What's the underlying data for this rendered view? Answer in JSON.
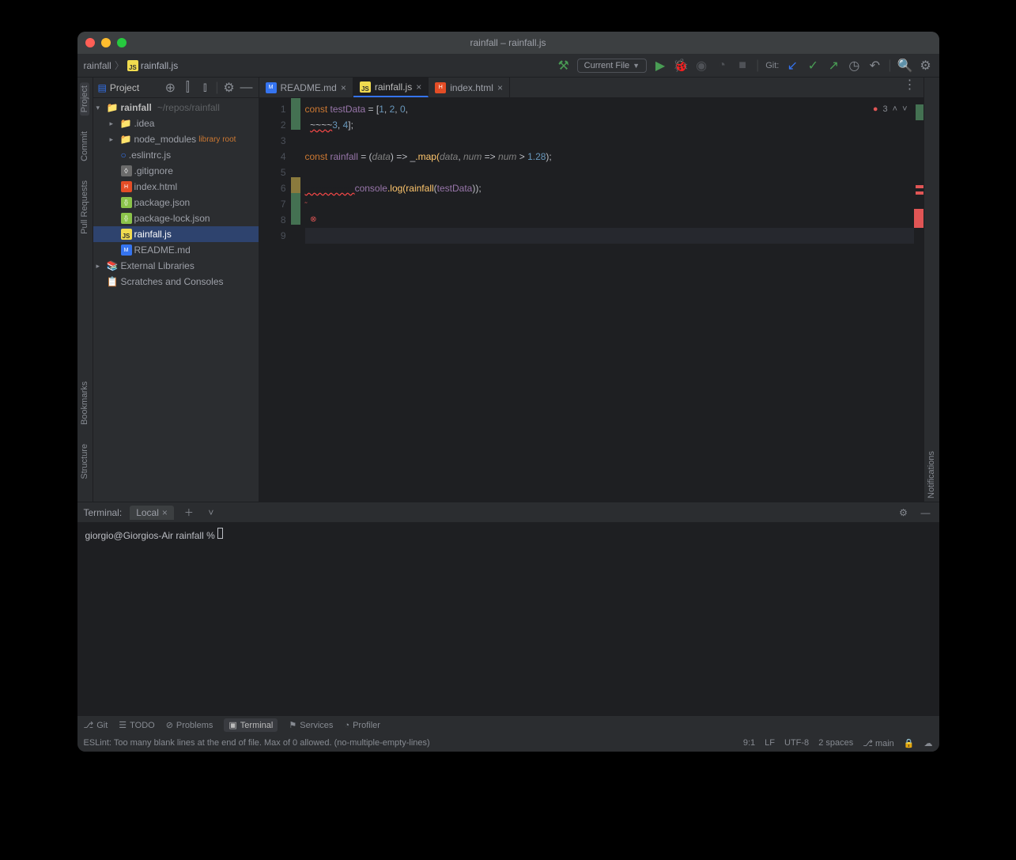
{
  "window": {
    "title": "rainfall – rainfall.js"
  },
  "breadcrumbs": {
    "project": "rainfall",
    "file": "rainfall.js"
  },
  "toolbar": {
    "run_config": "Current File",
    "git_label": "Git:"
  },
  "sidebar": {
    "title": "Project",
    "tree": {
      "root": "rainfall",
      "root_path": "~/repos/rainfall",
      "idea": ".idea",
      "node_modules": "node_modules",
      "lib_root": "library root",
      "eslintrc": ".eslintrc.js",
      "gitignore": ".gitignore",
      "index_html": "index.html",
      "package_json": "package.json",
      "package_lock": "package-lock.json",
      "rainfall_js": "rainfall.js",
      "readme": "README.md",
      "ext_libs": "External Libraries",
      "scratches": "Scratches and Consoles"
    }
  },
  "left_rail": {
    "project": "Project",
    "commit": "Commit",
    "pull_requests": "Pull Requests",
    "structure": "Structure",
    "bookmarks": "Bookmarks"
  },
  "right_rail": {
    "notifications": "Notifications"
  },
  "tabs": [
    {
      "label": "README.md",
      "type": "md"
    },
    {
      "label": "rainfall.js",
      "type": "js",
      "active": true
    },
    {
      "label": "index.html",
      "type": "html"
    }
  ],
  "editor": {
    "inspection": {
      "errors": 3
    },
    "lines": [
      "1",
      "2",
      "3",
      "4",
      "5",
      "6",
      "7",
      "8",
      "9"
    ],
    "code": {
      "l1_kw": "const ",
      "l1_var": "testData",
      "l1_op": " = [",
      "l1_n1": "1",
      "l1_c": ", ",
      "l1_n2": "2",
      "l1_n3": "0",
      "l2_sq": "~~~~",
      "l2_n1": "3",
      "l2_n2": "4",
      "l2_end": "];",
      "l4_kw": "const ",
      "l4_var": "rainfall",
      "l4_op": " = (",
      "l4_p": "data",
      "l4_ar": ") => ",
      "l4_u": "_",
      "l4_map": ".map(",
      "l4_d": "data",
      "l4_c": ", ",
      "l4_n": "num",
      "l4_ar2": " => ",
      "l4_n2": "num",
      "l4_gt": " > ",
      "l4_val": "1.28",
      "l4_end": ");",
      "l6_sq": "~~~~~~~~~",
      "l6_con": "console",
      "l6_log": ".log(",
      "l6_fn": "rainfall",
      "l6_op": "(",
      "l6_arg": "testData",
      "l6_end": "));"
    }
  },
  "terminal": {
    "label": "Terminal:",
    "tab": "Local",
    "prompt": "giorgio@Giorgios-Air rainfall % "
  },
  "bottom_tools": {
    "git": "Git",
    "todo": "TODO",
    "problems": "Problems",
    "terminal": "Terminal",
    "services": "Services",
    "profiler": "Profiler"
  },
  "status": {
    "message": "ESLint: Too many blank lines at the end of file. Max of 0 allowed. (no-multiple-empty-lines)",
    "pos": "9:1",
    "le": "LF",
    "enc": "UTF-8",
    "indent": "2 spaces",
    "branch": "main"
  }
}
